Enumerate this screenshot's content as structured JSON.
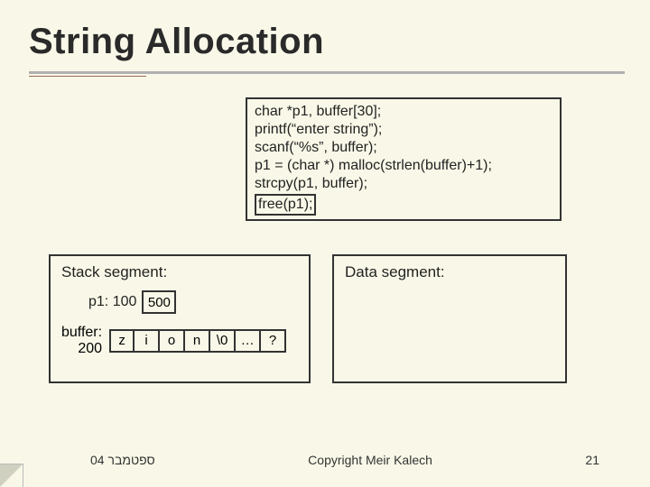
{
  "title": "String Allocation",
  "code": {
    "l1": "char *p1, buffer[30];",
    "l2": "printf(“enter string”);",
    "l3": "scanf(“%s”, buffer);",
    "l4": "p1 = (char *) malloc(strlen(buffer)+1);",
    "l5": "strcpy(p1, buffer);",
    "l6": "free(p1);"
  },
  "stack": {
    "title": "Stack segment:",
    "p1_label": "p1: 100",
    "p1_value": "500",
    "buf_label_top": "buffer:",
    "buf_label_bottom": "200",
    "cells": [
      "z",
      "i",
      "o",
      "n",
      "\\0",
      "…",
      "?"
    ]
  },
  "data": {
    "title": "Data segment:"
  },
  "footer": {
    "left": "ספטמבר 04",
    "center": "Copyright Meir Kalech",
    "right": "21"
  }
}
